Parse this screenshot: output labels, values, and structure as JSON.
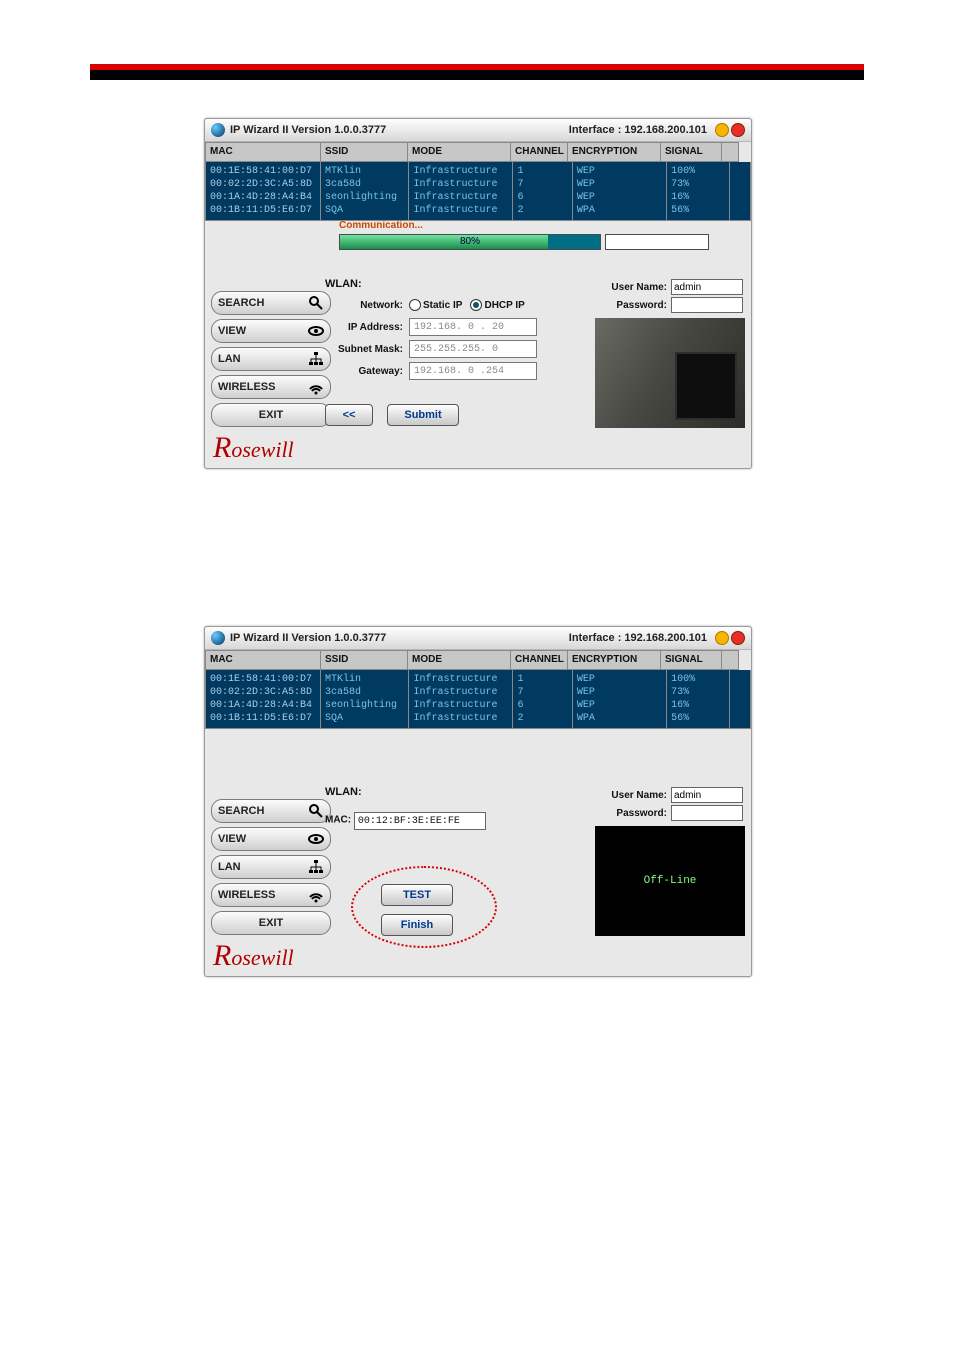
{
  "titlebar": {
    "title": "IP Wizard II  Version 1.0.0.3777",
    "interface_label": "Interface : 192.168.200.101"
  },
  "columns": {
    "mac": "MAC",
    "ssid": "SSID",
    "mode": "MODE",
    "channel": "CHANNEL",
    "encryption": "ENCRYPTION",
    "signal": "SIGNAL"
  },
  "rows": [
    {
      "mac": "00:1E:58:41:00:D7",
      "ssid": "MTKlin",
      "mode": "Infrastructure",
      "channel": "1",
      "encryption": "WEP",
      "signal": "100%"
    },
    {
      "mac": "00:02:2D:3C:A5:8D",
      "ssid": "3ca58d",
      "mode": "Infrastructure",
      "channel": "7",
      "encryption": "WEP",
      "signal": "73%"
    },
    {
      "mac": "00:1A:4D:28:A4:B4",
      "ssid": "seonlighting",
      "mode": "Infrastructure",
      "channel": "6",
      "encryption": "WEP",
      "signal": "16%"
    },
    {
      "mac": "00:1B:11:D5:E6:D7",
      "ssid": "SQA",
      "mode": "Infrastructure",
      "channel": "2",
      "encryption": "WPA",
      "signal": "56%"
    }
  ],
  "comm": {
    "label": "Communication...",
    "pct": "80%"
  },
  "nav": {
    "search": "SEARCH",
    "view": "VIEW",
    "lan": "LAN",
    "wireless": "WIRELESS",
    "exit": "EXIT"
  },
  "wlan": {
    "title": "WLAN:",
    "network_label": "Network:",
    "static": "Static IP",
    "dhcp": "DHCP IP",
    "ip_label": "IP Address:",
    "ip": "192.168. 0 . 20",
    "mask_label": "Subnet Mask:",
    "mask": "255.255.255. 0",
    "gw_label": "Gateway:",
    "gw": "192.168. 0 .254"
  },
  "btn": {
    "back": "<<",
    "submit": "Submit",
    "test": "TEST",
    "finish": "Finish"
  },
  "cred": {
    "user_label": "User Name:",
    "user": "admin",
    "pass_label": "Password:"
  },
  "mac_form": {
    "label": "MAC:",
    "value": "00:12:BF:3E:EE:FE"
  },
  "offline": "Off-Line",
  "logo": "Rosewill"
}
